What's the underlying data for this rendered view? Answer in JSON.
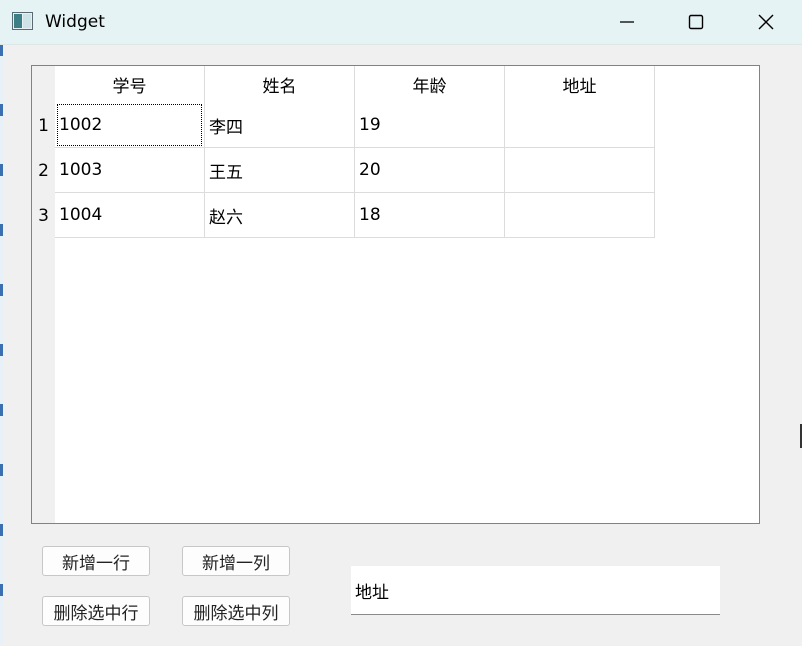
{
  "window": {
    "title": "Widget",
    "icon": "app-window-icon",
    "controls": [
      "minimize-icon",
      "maximize-icon",
      "close-icon"
    ]
  },
  "table": {
    "columns": [
      "学号",
      "姓名",
      "年龄",
      "地址"
    ],
    "rows": [
      {
        "header": "1",
        "cells": [
          "1002",
          "李四",
          "19",
          ""
        ]
      },
      {
        "header": "2",
        "cells": [
          "1003",
          "王五",
          "20",
          ""
        ]
      },
      {
        "header": "3",
        "cells": [
          "1004",
          "赵六",
          "18",
          ""
        ]
      }
    ]
  },
  "buttons": {
    "add_row": "新增一行",
    "add_column": "新增一列",
    "delete_row": "删除选中行",
    "delete_column": "删除选中列"
  },
  "input": {
    "value": "地址"
  }
}
